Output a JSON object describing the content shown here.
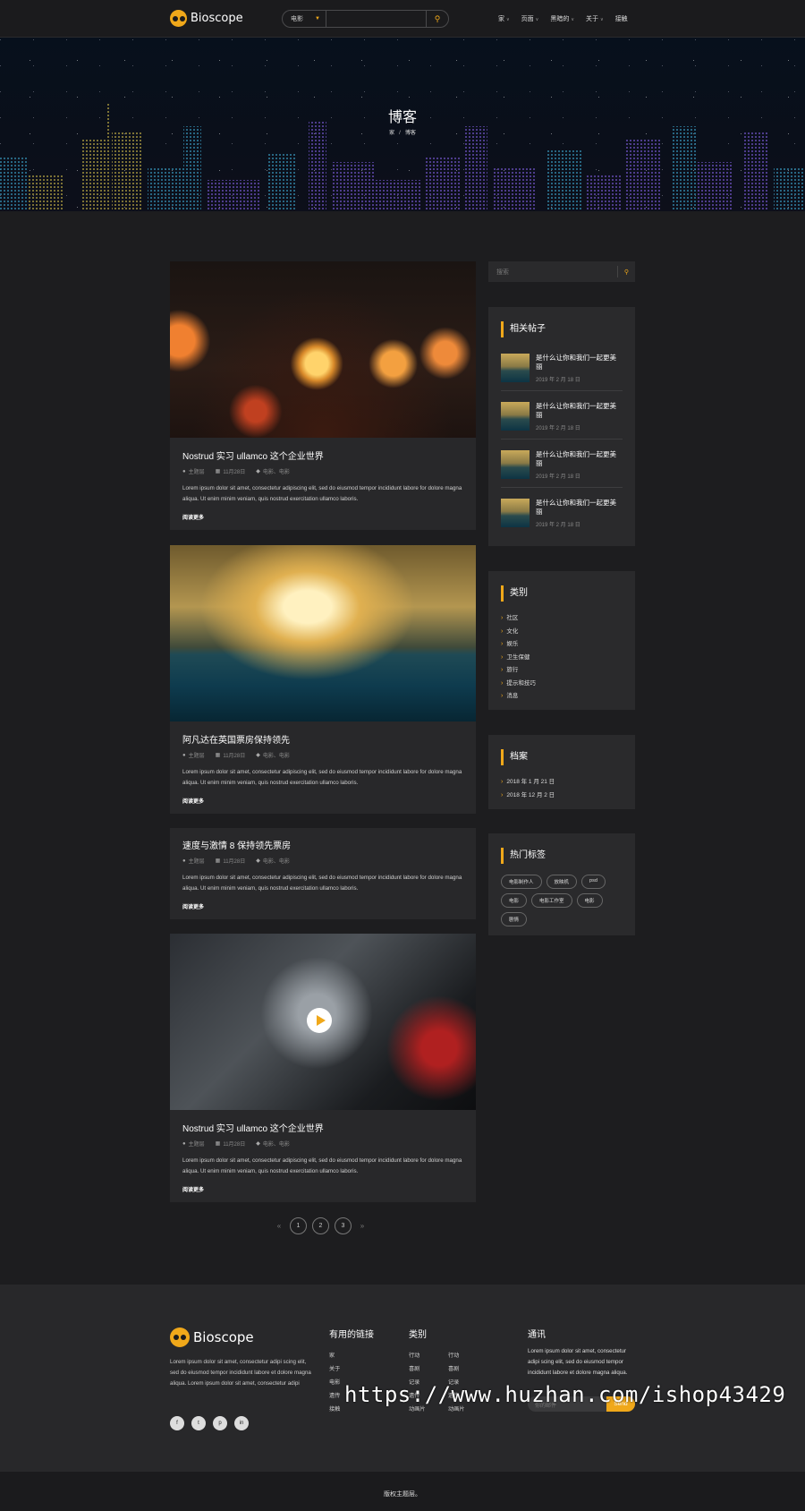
{
  "header": {
    "logo": "Bioscope",
    "search_category": "电影",
    "nav": [
      "家",
      "页面",
      "黑暗的",
      "关于",
      "接触"
    ]
  },
  "hero": {
    "title": "博客",
    "breadcrumb": [
      "家",
      "博客"
    ]
  },
  "posts": [
    {
      "title": "Nostrud 实习 ullamco 这个企业世界",
      "author": "主题层",
      "date": "11月28日",
      "tags": "电影、电影",
      "excerpt": "Lorem ipsum dolor sit amet, consectetur adipiscing elit, sed do eiusmod tempor incididunt labore for dolore magna aliqua. Ut enim minim veniam, quis nostrud exercitation ullamco laboris.",
      "more": "阅读更多"
    },
    {
      "title": "阿凡达在英国票房保持领先",
      "author": "主题层",
      "date": "11月28日",
      "tags": "电影、电影",
      "excerpt": "Lorem ipsum dolor sit amet, consectetur adipiscing elit, sed do eiusmod tempor incididunt labore for dolore magna aliqua. Ut enim minim veniam, quis nostrud exercitation ullamco laboris.",
      "more": "阅读更多"
    },
    {
      "title": "速度与激情 8 保持领先票房",
      "author": "主题层",
      "date": "11月28日",
      "tags": "电影、电影",
      "excerpt": "Lorem ipsum dolor sit amet, consectetur adipiscing elit, sed do eiusmod tempor incididunt labore for dolore magna aliqua. Ut enim minim veniam, quis nostrud exercitation ullamco laboris.",
      "more": "阅读更多"
    },
    {
      "title": "Nostrud 实习 ullamco 这个企业世界",
      "author": "主题层",
      "date": "11月28日",
      "tags": "电影、电影",
      "excerpt": "Lorem ipsum dolor sit amet, consectetur adipiscing elit, sed do eiusmod tempor incididunt labore for dolore magna aliqua. Ut enim minim veniam, quis nostrud exercitation ullamco laboris.",
      "more": "阅读更多"
    }
  ],
  "pagination": {
    "prev": "«",
    "pages": [
      "1",
      "2",
      "3"
    ],
    "next": "»"
  },
  "sidebar": {
    "search_placeholder": "搜索",
    "related_title": "相关帖子",
    "related": [
      {
        "title": "是什么让你和我们一起更美丽",
        "date": "2019 年 2 月 18 日"
      },
      {
        "title": "是什么让你和我们一起更美丽",
        "date": "2019 年 2 月 18 日"
      },
      {
        "title": "是什么让你和我们一起更美丽",
        "date": "2019 年 2 月 18 日"
      },
      {
        "title": "是什么让你和我们一起更美丽",
        "date": "2019 年 2 月 18 日"
      }
    ],
    "categories_title": "类别",
    "categories": [
      "社区",
      "文化",
      "娱乐",
      "卫生保健",
      "旅行",
      "提示和技巧",
      "消息"
    ],
    "archive_title": "档案",
    "archive": [
      "2018 年 1 月 21 日",
      "2018 年 12 月 2 日"
    ],
    "tags_title": "热门标签",
    "tags": [
      "电影制作人",
      "放映机",
      "psd",
      "电影",
      "电影工作室",
      "电影",
      "剧情"
    ]
  },
  "footer": {
    "logo": "Bioscope",
    "about": "Lorem ipsum dolor sit amet, consectetur adipi scing elit, sed do eiusmod tempor incididunt labore et dolore magna aliqua. Lorem ipsum dolor sit amet, consectetur adipi",
    "social": [
      "f",
      "t",
      "p",
      "in"
    ],
    "links_title": "有用的链接",
    "links": [
      "家",
      "关于",
      "电影",
      "遗传",
      "接触"
    ],
    "cat_title": "类别",
    "cats_a": [
      "行动",
      "喜剧",
      "记录",
      "遗传",
      "动画片"
    ],
    "cats_b": [
      "行动",
      "喜剧",
      "记录",
      "遗传",
      "动画片"
    ],
    "news_title": "通讯",
    "news_text": "Lorem ipsum dolor sit amet, consectetur adipi scing elit, sed do eiusmod tempor incididunt labore et dolore magna aliqua.",
    "email_placeholder": "你的邮件",
    "send": "Send",
    "watermark": "https://www.huzhan.com/ishop43429",
    "copyright": "版权主题层。"
  },
  "colors": {
    "accent": "#f0a81a",
    "background": "#1d1d1f",
    "card": "#28282a"
  }
}
